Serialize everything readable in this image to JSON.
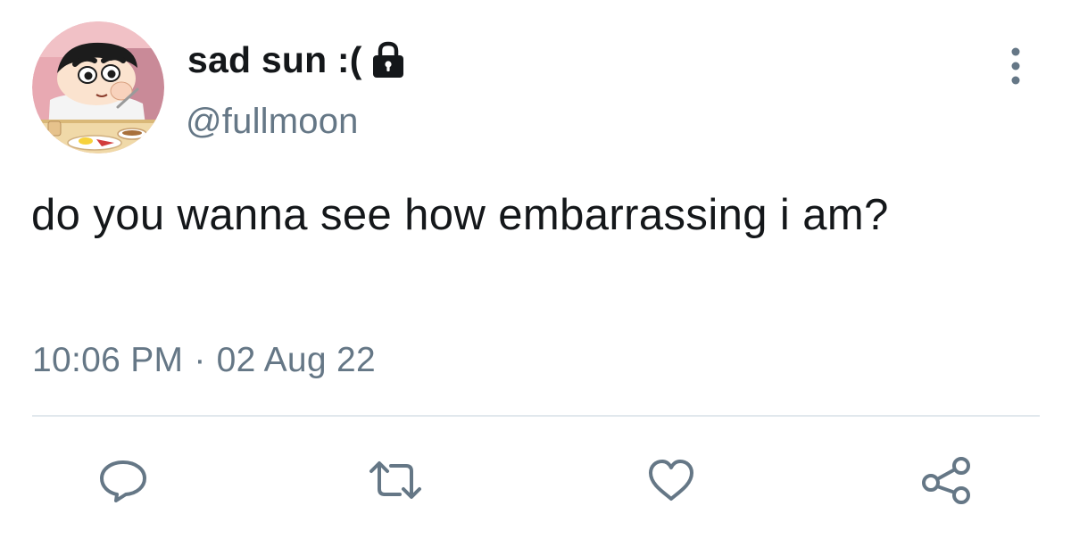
{
  "tweet": {
    "display_name": "sad sun :(",
    "handle": "@fullmoon",
    "text": "do you wanna see how embarrassing i am?",
    "time": "10:06 PM",
    "separator": "·",
    "date": "02 Aug 22"
  },
  "icons": {
    "lock": "lock-icon",
    "more": "more-vertical-icon",
    "reply": "reply-icon",
    "retweet": "retweet-icon",
    "like": "heart-icon",
    "share": "share-icon"
  },
  "colors": {
    "text": "#14171a",
    "secondary": "#657786",
    "divider": "#e1e8ed"
  }
}
